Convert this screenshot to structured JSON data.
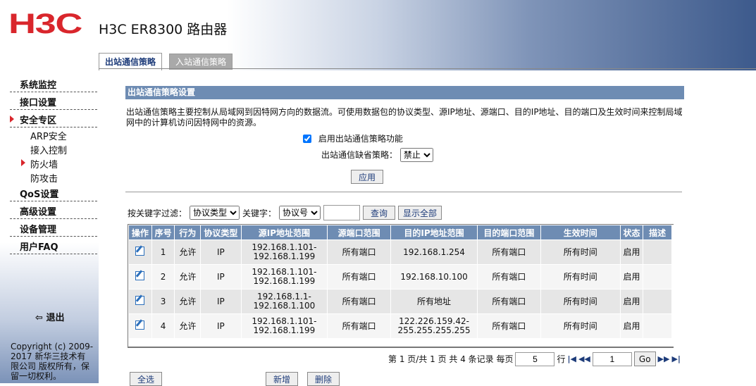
{
  "header": {
    "logo": "H3C",
    "product": "H3C ER8300 路由器"
  },
  "tabs": [
    {
      "label": "出站通信策略"
    },
    {
      "label": "入站通信策略"
    }
  ],
  "sidebar": {
    "items": [
      {
        "label": "系统监控"
      },
      {
        "label": "接口设置"
      },
      {
        "label": "安全专区"
      },
      {
        "label": "QoS设置"
      },
      {
        "label": "高级设置"
      },
      {
        "label": "设备管理"
      },
      {
        "label": "用户FAQ"
      }
    ],
    "sub_items": [
      {
        "label": "ARP安全"
      },
      {
        "label": "接入控制"
      },
      {
        "label": "防火墙"
      },
      {
        "label": "防攻击"
      }
    ],
    "logout": "退出",
    "copyright": "Copyright (c) 2009-2017 新华三技术有限公司 版权所有，保留一切权利。"
  },
  "section": {
    "title": "出站通信策略设置",
    "description": "出站通信策略主要控制从局域网到因特网方向的数据流。可使用数据包的协议类型、源IP地址、源端口、目的IP地址、目的端口及生效时间来控制局域网中的计算机访问因特网中的资源。",
    "enable_label": "启用出站通信策略功能",
    "default_label": "出站通信缺省策略：",
    "default_value": "禁止",
    "apply": "应用"
  },
  "filter": {
    "label": "按关键字过滤：",
    "field_value": "协议类型",
    "keyword_label": "关键字：",
    "keyword_value": "协议号",
    "search": "查询",
    "show_all": "显示全部"
  },
  "table": {
    "headers": [
      "操作",
      "序号",
      "行为",
      "协议类型",
      "源IP地址范围",
      "源端口范围",
      "目的IP地址范围",
      "目的端口范围",
      "生效时间",
      "状态",
      "描述"
    ],
    "rows": [
      {
        "no": "1",
        "action": "允许",
        "protocol": "IP",
        "src_ip1": "192.168.1.101-",
        "src_ip2": "192.168.1.199",
        "src_port": "所有端口",
        "dst_ip1": "192.168.1.254",
        "dst_ip2": "",
        "dst_port": "所有端口",
        "time": "所有时间",
        "status": "启用",
        "desc": ""
      },
      {
        "no": "2",
        "action": "允许",
        "protocol": "IP",
        "src_ip1": "192.168.1.101-",
        "src_ip2": "192.168.1.199",
        "src_port": "所有端口",
        "dst_ip1": "192.168.10.100",
        "dst_ip2": "",
        "dst_port": "所有端口",
        "time": "所有时间",
        "status": "启用",
        "desc": ""
      },
      {
        "no": "3",
        "action": "允许",
        "protocol": "IP",
        "src_ip1": "192.168.1.1-",
        "src_ip2": "192.168.1.100",
        "src_port": "所有端口",
        "dst_ip1": "所有地址",
        "dst_ip2": "",
        "dst_port": "所有端口",
        "time": "所有时间",
        "status": "启用",
        "desc": ""
      },
      {
        "no": "4",
        "action": "允许",
        "protocol": "IP",
        "src_ip1": "192.168.1.101-",
        "src_ip2": "192.168.1.199",
        "src_port": "所有端口",
        "dst_ip1": "122.226.159.42-",
        "dst_ip2": "255.255.255.255",
        "dst_port": "所有端口",
        "time": "所有时间",
        "status": "启用",
        "desc": ""
      }
    ]
  },
  "pager": {
    "summary": "第 1 页/共 1 页 共 4 条记录 每页",
    "per_page": "5",
    "unit": "行",
    "page": "1",
    "go": "Go"
  },
  "bottom": {
    "select_all": "全选",
    "add": "新增",
    "delete": "删除"
  },
  "colors": {
    "brand": "#d9262c",
    "header_blue": "#6e8cb3"
  }
}
